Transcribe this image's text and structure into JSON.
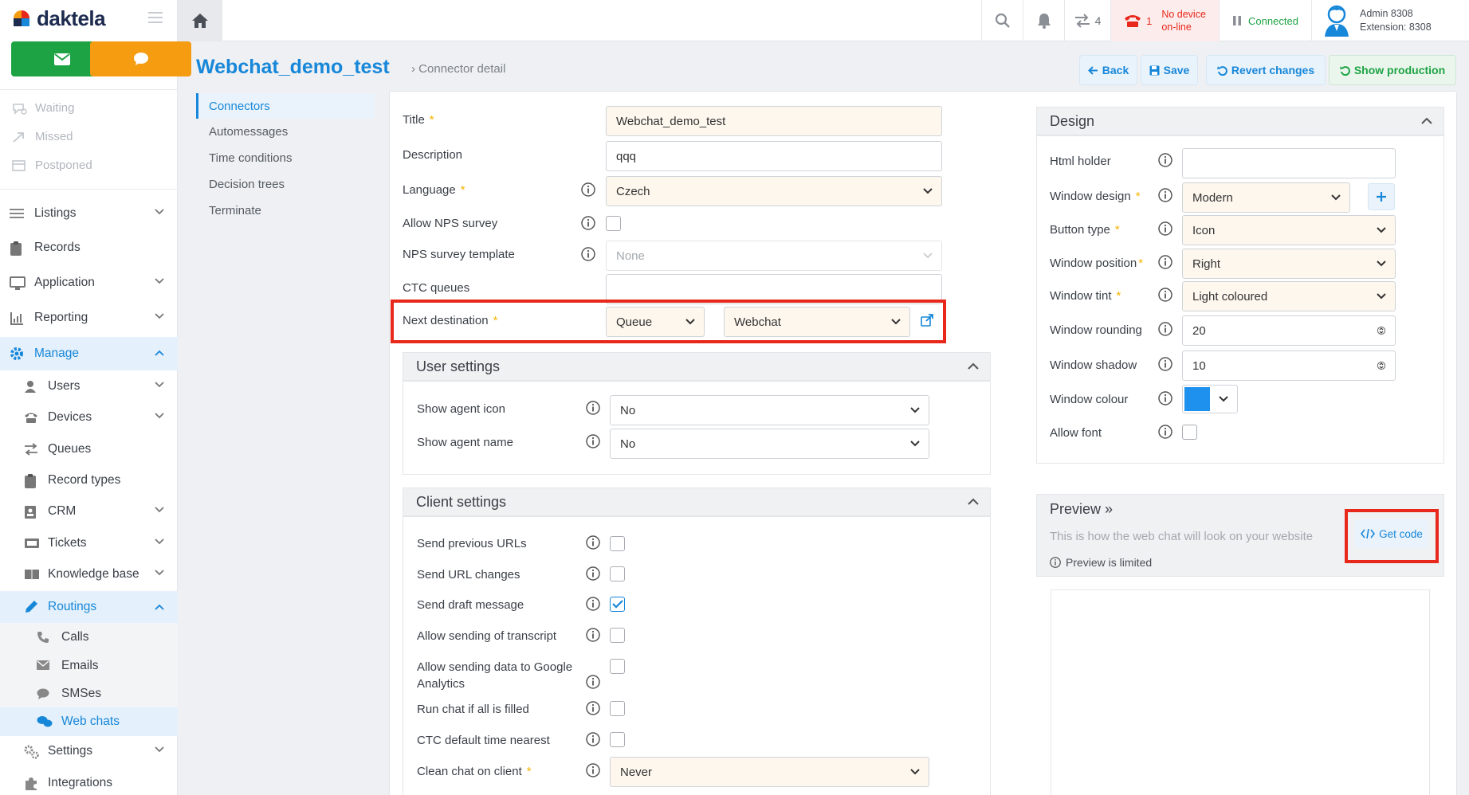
{
  "app": {
    "brand": "daktela"
  },
  "sidebar": {
    "stats": [
      {
        "label": "Waiting"
      },
      {
        "label": "Missed"
      },
      {
        "label": "Postponed"
      }
    ],
    "nav": {
      "listings": "Listings",
      "records": "Records",
      "application": "Application",
      "reporting": "Reporting",
      "manage": "Manage",
      "users": "Users",
      "devices": "Devices",
      "queues": "Queues",
      "record_types": "Record types",
      "crm": "CRM",
      "tickets": "Tickets",
      "knowledge_base": "Knowledge base",
      "routings": "Routings",
      "calls": "Calls",
      "emails": "Emails",
      "smses": "SMSes",
      "web_chats": "Web chats",
      "settings": "Settings",
      "integrations": "Integrations"
    }
  },
  "topbar": {
    "transfers_count": "4",
    "calls_count": "1",
    "device_status_line1": "No device",
    "device_status_line2": "on-line",
    "connection_status": "Connected",
    "user_name": "Admin 8308",
    "user_extension": "Extension: 8308",
    "colors": {
      "alert_red": "#e8281b",
      "connected_green": "#1ea344",
      "accent_blue": "#1787d9"
    }
  },
  "header": {
    "title": "Webchat_demo_test",
    "breadcrumb": "Connector detail",
    "actions": {
      "back": "Back",
      "save": "Save",
      "revert": "Revert changes",
      "show_production": "Show production"
    }
  },
  "subnav": [
    "Connectors",
    "Automessages",
    "Time conditions",
    "Decision trees",
    "Terminate"
  ],
  "form": {
    "title_label": "Title",
    "title_value": "Webchat_demo_test",
    "description_label": "Description",
    "description_value": "qqq",
    "language_label": "Language",
    "language_value": "Czech",
    "nps_label": "Allow NPS survey",
    "nps_template_label": "NPS survey template",
    "nps_template_value": "None",
    "ctc_label": "CTC queues",
    "next_dest_label": "Next destination",
    "next_dest_type": "Queue",
    "next_dest_value": "Webchat"
  },
  "user_settings": {
    "title": "User settings",
    "show_icon_label": "Show agent icon",
    "show_icon_value": "No",
    "show_name_label": "Show agent name",
    "show_name_value": "No"
  },
  "client_settings": {
    "title": "Client settings",
    "prev_urls": "Send previous URLs",
    "url_changes": "Send URL changes",
    "draft": "Send draft message",
    "transcript": "Allow sending of transcript",
    "ga_line1": "Allow sending data to Google",
    "ga_line2": "Analytics",
    "run_chat": "Run chat if all is filled",
    "ctc_default": "CTC default time nearest",
    "clean_label": "Clean chat on client",
    "clean_value": "Never"
  },
  "design": {
    "title": "Design",
    "html_holder": "Html holder",
    "window_design": "Window design",
    "window_design_value": "Modern",
    "button_type": "Button type",
    "button_type_value": "Icon",
    "window_position": "Window position",
    "window_position_value": "Right",
    "window_tint": "Window tint",
    "window_tint_value": "Light coloured",
    "window_rounding": "Window rounding",
    "window_rounding_value": "20",
    "window_shadow": "Window shadow",
    "window_shadow_value": "10",
    "window_colour": "Window colour",
    "window_colour_hex": "#1e90ee",
    "allow_font": "Allow font"
  },
  "preview": {
    "title": "Preview »",
    "desc": "This is how the web chat will look on your website",
    "get_code": "Get code",
    "limited": "Preview is limited"
  }
}
